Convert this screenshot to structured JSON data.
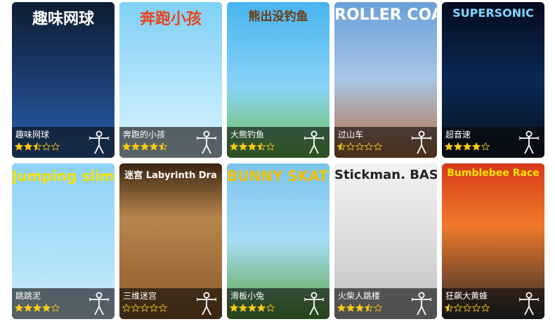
{
  "games": [
    {
      "art_title": "趣味网球",
      "name": "趣味网球",
      "rating": 2.5,
      "art_color": "#ffffff"
    },
    {
      "art_title": "奔跑小孩",
      "name": "奔跑的小孩",
      "rating": 4.5,
      "art_color": "#e8441b"
    },
    {
      "art_title": "熊出没钓鱼",
      "name": "大熊钓鱼",
      "rating": 3.5,
      "art_color": "#6b3b12"
    },
    {
      "art_title": "ROLLER COASTER",
      "name": "过山车",
      "rating": 0.5,
      "art_color": "#ffffff"
    },
    {
      "art_title": "SUPERSONIC",
      "name": "超音速",
      "rating": 4,
      "art_color": "#7fd6ff"
    },
    {
      "art_title": "Jumping slime",
      "name": "跳跳泥",
      "rating": 4,
      "art_color": "#f5e100"
    },
    {
      "art_title": "迷宫 Labyrinth Dra",
      "name": "三维迷宫",
      "rating": 0,
      "art_color": "#ffffff"
    },
    {
      "art_title": "BUNNY SKATER",
      "name": "滑板小兔",
      "rating": 4,
      "art_color": "#f3c200"
    },
    {
      "art_title": "Stickman. BASE Jumper",
      "name": "火柴人跳楼",
      "rating": 3.5,
      "art_color": "#222222"
    },
    {
      "art_title": "Bumblebee Race",
      "name": "狂飙大黄蜂",
      "rating": 0.5,
      "art_color": "#ffe400"
    }
  ],
  "icons": {
    "rating": "star-icon",
    "motion_control": "motion-control-icon"
  },
  "colors": {
    "star_fill": "#f6c913",
    "star_empty": "#f6c913",
    "overlay": "#0a0a0a"
  }
}
